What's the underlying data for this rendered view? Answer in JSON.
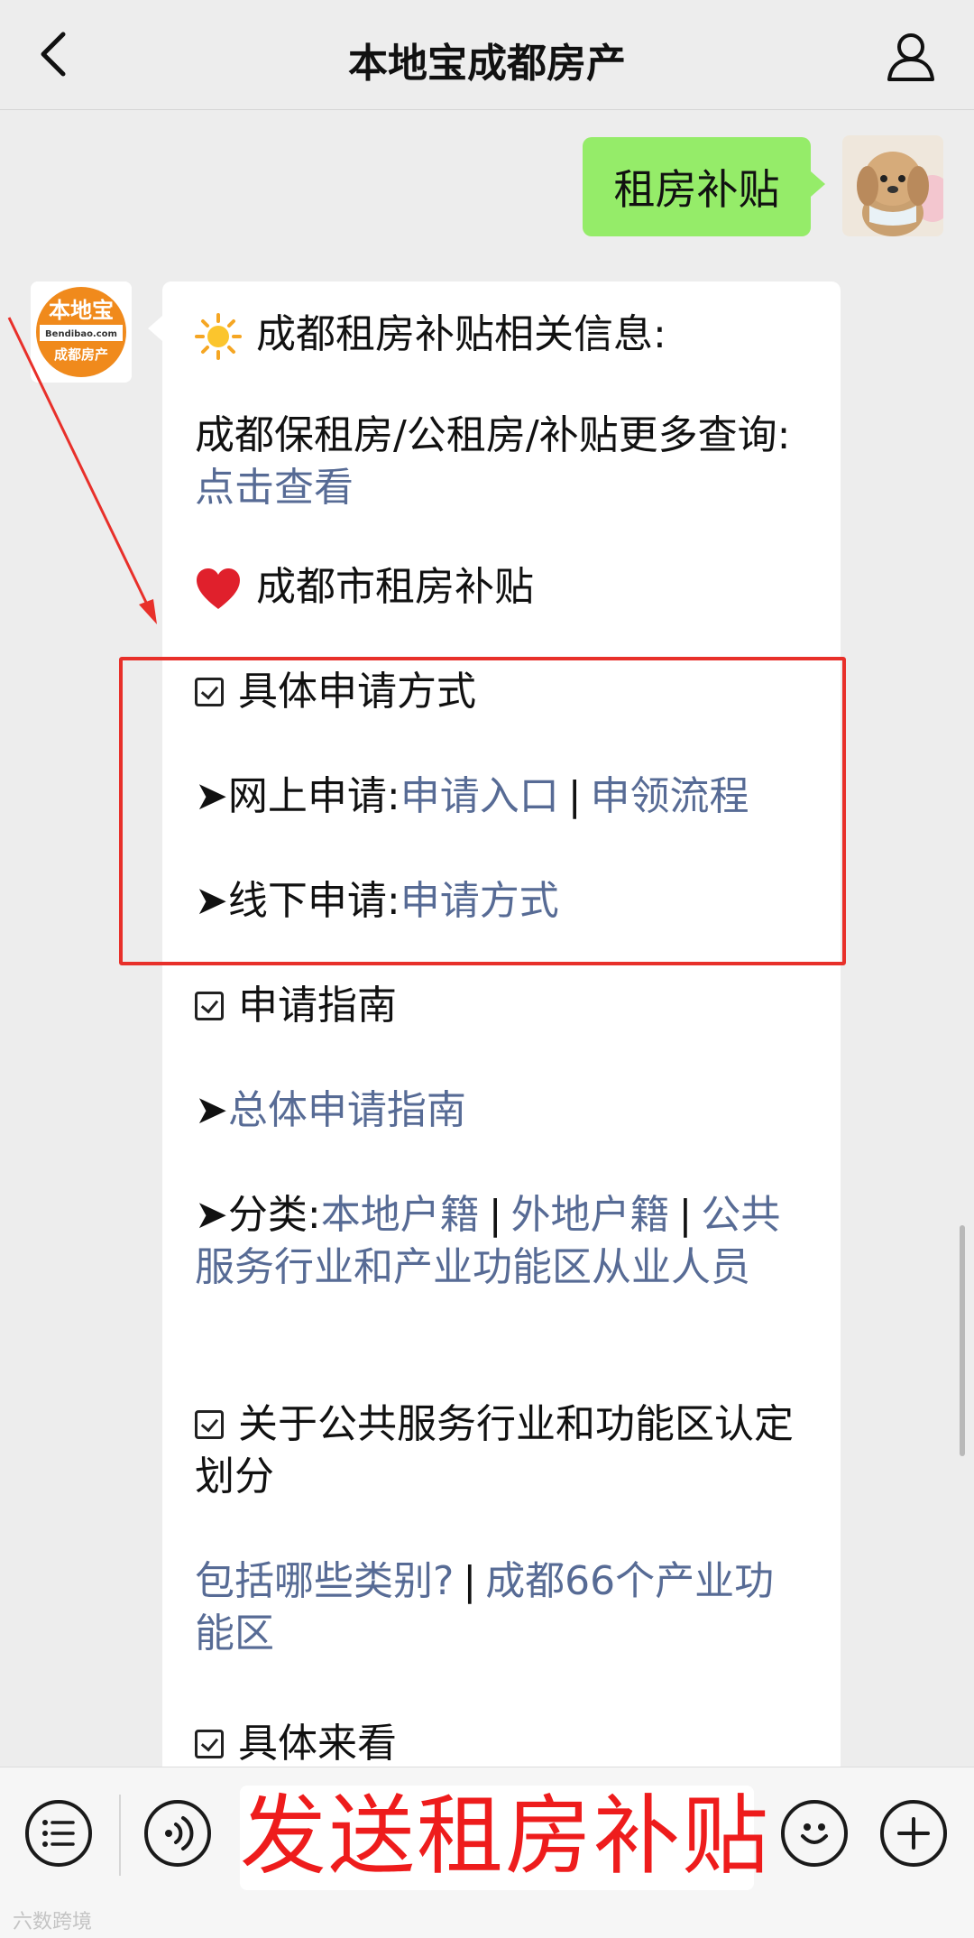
{
  "header": {
    "title": "本地宝成都房产",
    "back_icon": "chevron-left-icon",
    "profile_icon": "person-icon"
  },
  "user_message": {
    "text": "租房补贴"
  },
  "bot_avatar": {
    "logo_text": "本地宝",
    "logo_url_text": "Bendibao.com",
    "logo_sub_text": "成都房产"
  },
  "bot_message": {
    "heading": "成都租房补贴相关信息:",
    "more_prefix": "成都保租房/公租房/补贴更多查询:",
    "more_link": "点击查看",
    "section_title": "成都市租房补贴",
    "apply_method_title": "具体申请方式",
    "online_prefix": "➤网上申请:",
    "online_link_1": "申请入口",
    "online_sep": "|",
    "online_link_2": "申领流程",
    "offline_prefix": "➤线下申请:",
    "offline_link": "申请方式",
    "guide_title": "申请指南",
    "guide_arrow": "➤",
    "guide_link": "总体申请指南",
    "category_prefix": "➤分类:",
    "category_link_1": "本地户籍",
    "category_sep_1": "|",
    "category_link_2": "外地户籍",
    "category_sep_2": "|",
    "category_link_3": "公共服务行业和产业功能区从业人员",
    "division_title": "关于公共服务行业和功能区认定划分",
    "division_link_1": "包括哪些类别?",
    "division_sep": "|",
    "division_link_2": "成都66个产业功能区",
    "specific_title": "具体来看"
  },
  "input": {
    "value": "发送租房补贴"
  },
  "bottom_icons": [
    "list-menu-icon",
    "voice-icon",
    "emoji-icon",
    "plus-icon"
  ],
  "watermark": "六数跨境",
  "colors": {
    "background": "#ededed",
    "user_bubble": "#95ec69",
    "link": "#576b95",
    "annotation_red": "#e8302a"
  }
}
